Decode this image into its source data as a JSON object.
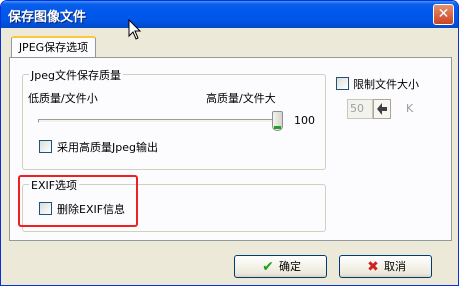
{
  "dialog": {
    "title": "保存图像文件",
    "close_symbol": "✕"
  },
  "tab": {
    "label": "JPEG保存选项"
  },
  "quality_group": {
    "legend": "Jpeg文件保存质量",
    "low_label": "低质量/文件小",
    "high_label": "高质量/文件大",
    "slider_value": "100",
    "slider_fraction": 1.0,
    "hq_checkbox_label": "采用高质量Jpeg输出",
    "hq_checked": false
  },
  "limit_size": {
    "checkbox_label": "限制文件大小",
    "checked": false,
    "value": "50",
    "unit": "K"
  },
  "exif_group": {
    "legend": "EXIF选项",
    "checkbox_label": "删除EXIF信息",
    "checked": false
  },
  "buttons": {
    "ok_label": "确定",
    "cancel_label": "取消"
  },
  "colors": {
    "title_bar": "#0058ee",
    "highlight_border": "#ee2020",
    "ok_icon": "#21a121",
    "cancel_icon": "#d02020"
  },
  "icons": {
    "ok": "checkmark-icon",
    "cancel": "cross-icon",
    "spin": "spin-arrow-icon",
    "cursor": "mouse-pointer-icon"
  }
}
